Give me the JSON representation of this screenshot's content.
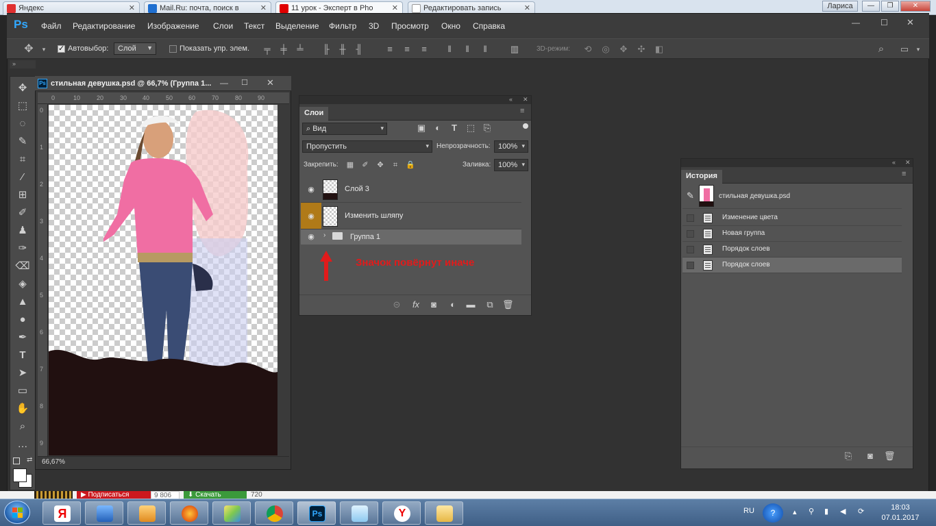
{
  "browser_tabs": [
    {
      "label": "Яндекс",
      "fav_color": "#e03030"
    },
    {
      "label": "Mail.Ru: почта, поиск в",
      "fav_color": "#1f6fd0"
    },
    {
      "label": "11 урок - Эксперт в Pho",
      "fav_color": "#e00000"
    },
    {
      "label": "Редактировать запись",
      "fav_color": "#999999"
    }
  ],
  "browser_user": "Лариса",
  "app": {
    "logo": "Ps"
  },
  "menu": [
    "Файл",
    "Редактирование",
    "Изображение",
    "Слои",
    "Текст",
    "Выделение",
    "Фильтр",
    "3D",
    "Просмотр",
    "Окно",
    "Справка"
  ],
  "options": {
    "autoselect_label": "Автовыбор:",
    "autoselect_value": "Слой",
    "show_transform_label": "Показать упр. элем.",
    "mode_3d_label": "3D-режим:"
  },
  "document": {
    "title": "стильная девушка.psd @ 66,7% (Группа 1...",
    "zoom": "66,67%",
    "ruler_top": [
      "0",
      "10",
      "20",
      "30",
      "40",
      "50",
      "60",
      "70",
      "80",
      "90"
    ],
    "ruler_left": [
      "0",
      "1",
      "2",
      "3",
      "4",
      "5",
      "6",
      "7",
      "8",
      "9"
    ]
  },
  "layers_panel": {
    "tab": "Слои",
    "filter_label": "Вид",
    "blend_mode": "Пропустить",
    "opacity_label": "Непрозрачность:",
    "opacity_value": "100%",
    "lock_label": "Закрепить:",
    "fill_label": "Заливка:",
    "fill_value": "100%",
    "layers": [
      {
        "name": "Слой 3"
      },
      {
        "name": "Изменить шляпу"
      },
      {
        "name": "Группа 1"
      }
    ],
    "annotation": "Значок повёрнут иначе",
    "annotation_color": "#e11b1b"
  },
  "history_panel": {
    "tab": "История",
    "snapshot": "стильная девушка.psd",
    "items": [
      "Изменение цвета",
      "Новая группа",
      "Порядок слоев",
      "Порядок слоев"
    ]
  },
  "background_page": {
    "subscribe": "Подписаться",
    "subscribers": "9 806",
    "download": "Скачать",
    "count": "720"
  },
  "system_tray": {
    "lang": "RU",
    "time": "18:03",
    "date": "07.01.2017"
  },
  "colors": {
    "selected_layer_eye": "#b07a18",
    "ps_blue": "#31a8ff"
  }
}
